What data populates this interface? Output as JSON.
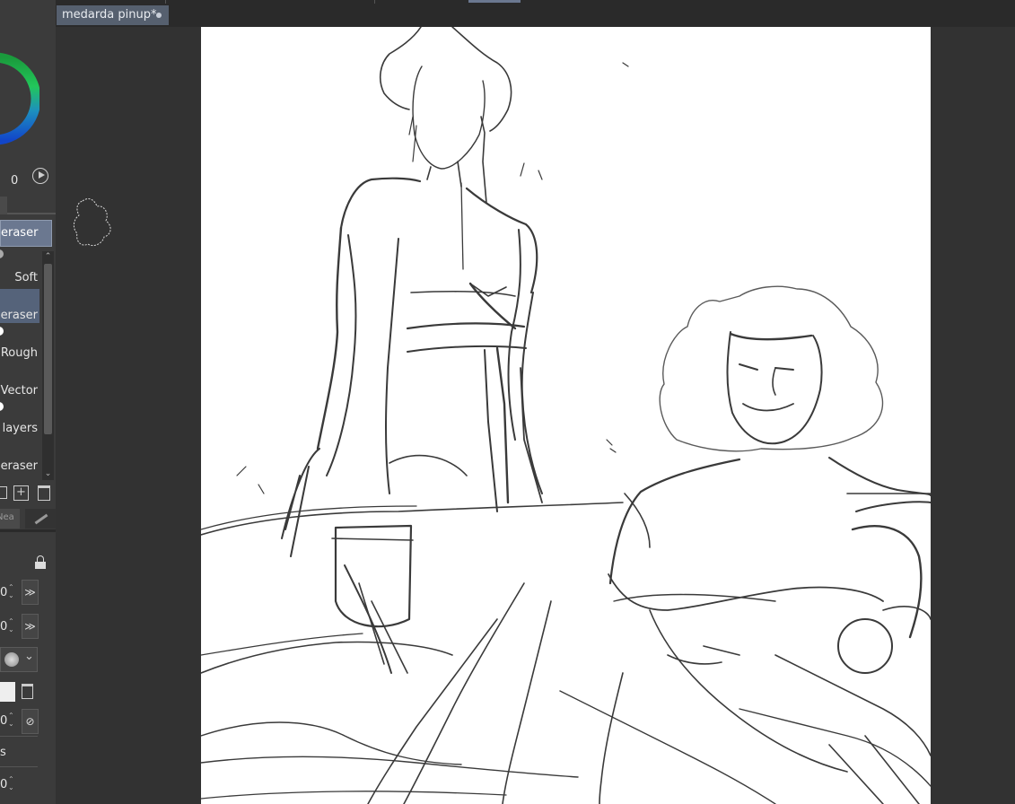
{
  "document_tab": {
    "title": "medarda pinup*"
  },
  "color_panel": {
    "value_label": "0"
  },
  "tool_panel": {
    "selected_tool": "eraser"
  },
  "subtool_list": {
    "items": [
      "Soft",
      "eraser",
      "Rough",
      "Vector",
      "e layers",
      "eraser"
    ]
  },
  "property_panel": {
    "tab_label": "Nea",
    "row1_value": "0",
    "row2_value": "0",
    "row3_value": "0",
    "row4_value": "0",
    "row5_label": "s"
  },
  "colors": {
    "accent": "#6b7890",
    "canvas": "#ffffff",
    "background": "#323232"
  }
}
